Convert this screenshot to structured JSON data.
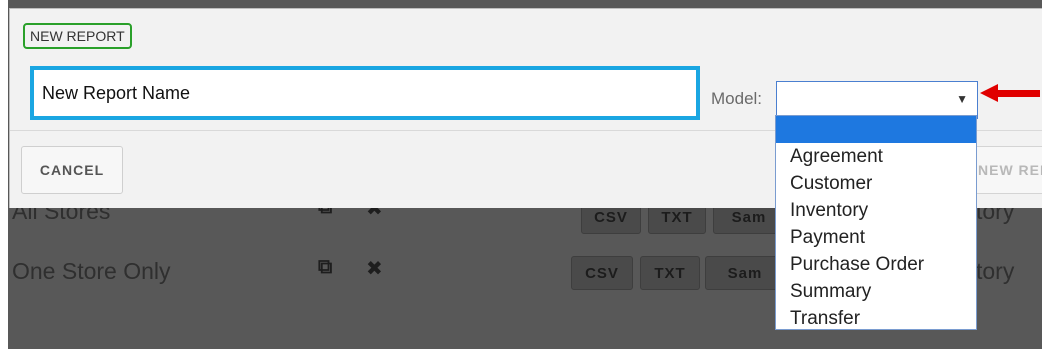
{
  "background": {
    "rows": [
      {
        "name": "All Stores",
        "buttons": [
          "CSV",
          "TXT",
          "Sam"
        ],
        "suffix": "tory"
      },
      {
        "name": "One Store Only",
        "buttons": [
          "CSV",
          "TXT",
          "Sam"
        ],
        "suffix": "tory"
      }
    ]
  },
  "modal": {
    "title": "NEW REPORT",
    "report_name_value": "New Report Name",
    "model_label": "Model:",
    "model_selected": "",
    "cancel_label": "CANCEL",
    "create_label": "NEW REP",
    "model_options": [
      "",
      "Agreement",
      "Customer",
      "Inventory",
      "Payment",
      "Purchase Order",
      "Summary",
      "Transfer"
    ]
  },
  "colors": {
    "input_highlight": "#1aa6e2",
    "title_highlight": "#2aa02a",
    "arrow": "#e00000",
    "selected_option": "#1e78e0",
    "overlay": "#585858"
  },
  "icons": {
    "copy": "copy-icon",
    "delete": "close-icon",
    "dropdown": "chevron-down-icon",
    "annotation": "red-arrow-icon"
  }
}
